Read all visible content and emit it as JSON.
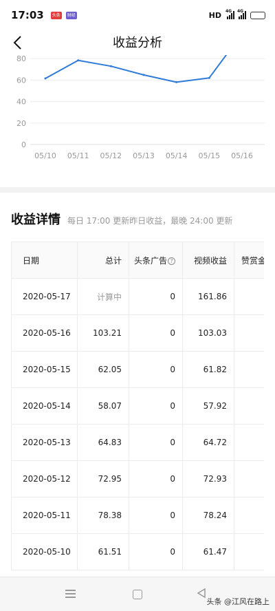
{
  "status_bar": {
    "time": "17:03",
    "app_badges": [
      "头条",
      "财经"
    ],
    "network": "HD",
    "signal_1": "4G",
    "signal_2": "4G",
    "battery_color": "#f0c800"
  },
  "header": {
    "title": "收益分析",
    "back_icon": "chevron-left-icon"
  },
  "chart_data": {
    "type": "line",
    "x": [
      "05/10",
      "05/11",
      "05/12",
      "05/13",
      "05/14",
      "05/15",
      "05/16"
    ],
    "y_ticks": [
      "80",
      "60",
      "40",
      "20",
      "0"
    ],
    "ylim": [
      0,
      80
    ],
    "series": [
      {
        "values": [
          61.51,
          78.38,
          72.95,
          64.83,
          58.07,
          62.05,
          103.21
        ]
      }
    ],
    "grid": true,
    "line_color": "#2f7bd8"
  },
  "details": {
    "title": "收益详情",
    "subtitle": "每日 17:00 更新昨日收益，最晚 24:00 更新",
    "columns": [
      "日期",
      "总计",
      "头条广告",
      "视频收益",
      "赞赏金"
    ],
    "help_icon": "question-circle-icon",
    "rows": [
      {
        "date": "2020-05-17",
        "total": "计算中",
        "ad": "0",
        "video": "161.86",
        "reward": ""
      },
      {
        "date": "2020-05-16",
        "total": "103.21",
        "ad": "0",
        "video": "103.03",
        "reward": ""
      },
      {
        "date": "2020-05-15",
        "total": "62.05",
        "ad": "0",
        "video": "61.82",
        "reward": ""
      },
      {
        "date": "2020-05-14",
        "total": "58.07",
        "ad": "0",
        "video": "57.92",
        "reward": ""
      },
      {
        "date": "2020-05-13",
        "total": "64.83",
        "ad": "0",
        "video": "64.72",
        "reward": ""
      },
      {
        "date": "2020-05-12",
        "total": "72.95",
        "ad": "0",
        "video": "72.93",
        "reward": ""
      },
      {
        "date": "2020-05-11",
        "total": "78.38",
        "ad": "0",
        "video": "78.24",
        "reward": ""
      },
      {
        "date": "2020-05-10",
        "total": "61.51",
        "ad": "0",
        "video": "61.47",
        "reward": ""
      }
    ]
  },
  "system_nav": {
    "icons": [
      "menu-icon",
      "home-icon",
      "back-triangle-icon"
    ]
  },
  "watermark": "头条 @江风在路上"
}
